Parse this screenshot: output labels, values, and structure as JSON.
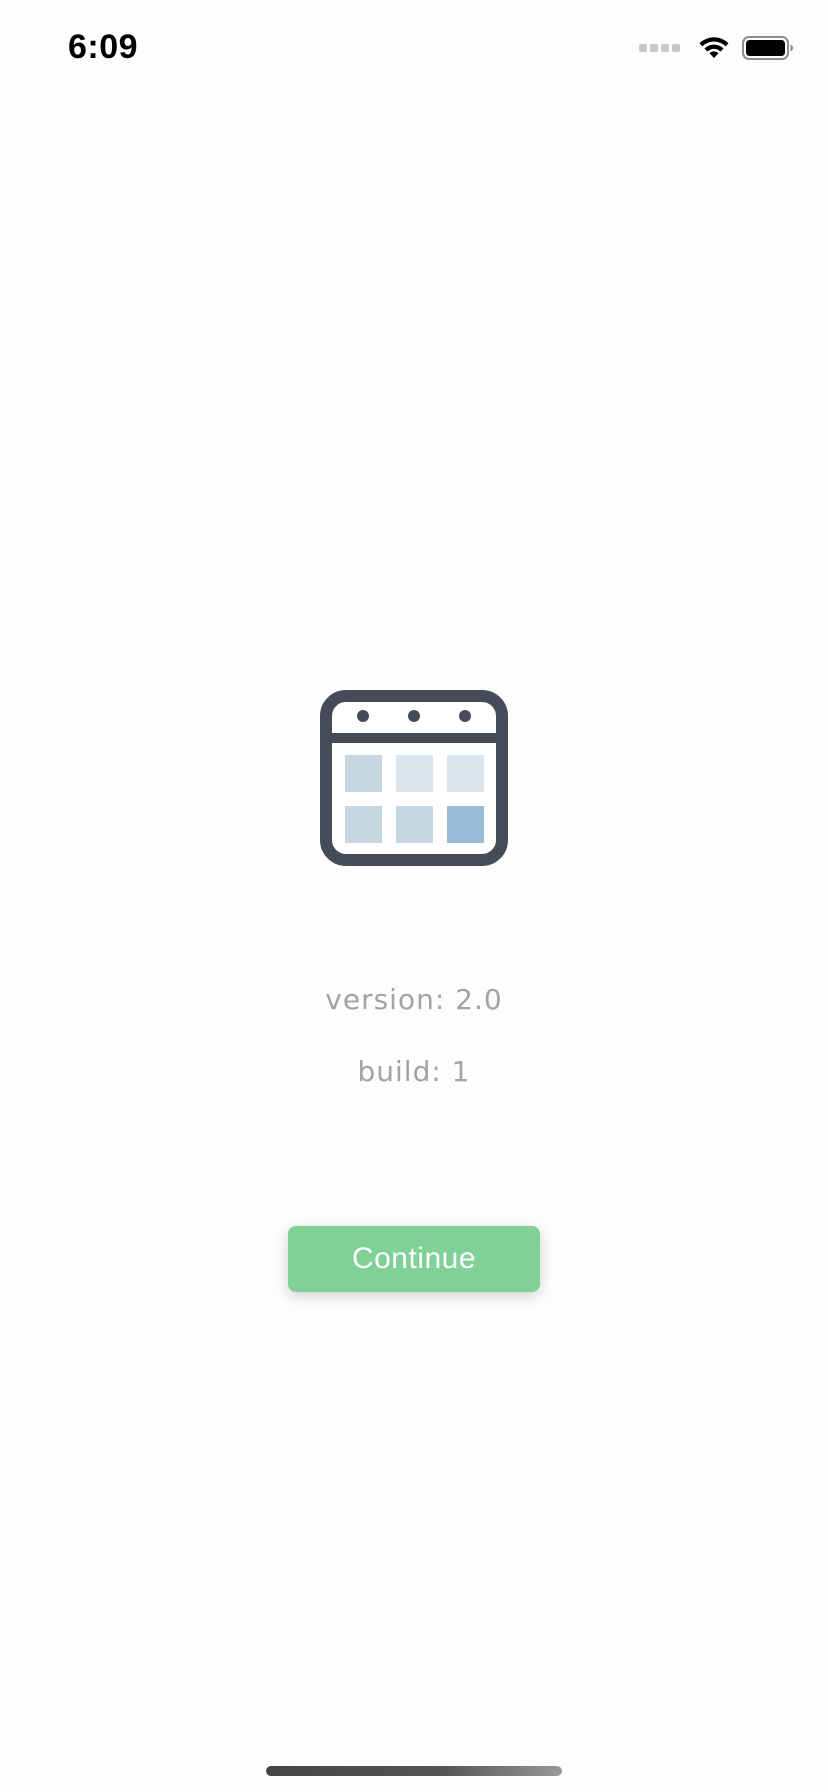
{
  "status_bar": {
    "time": "6:09",
    "icons": [
      "signal-icon",
      "wifi-icon",
      "battery-icon"
    ]
  },
  "app_icon": "calendar-icon",
  "info": {
    "version": "version: 2.0",
    "build": "build: 1"
  },
  "continue_button": {
    "label": "Continue"
  },
  "colors": {
    "button": "#7fd197",
    "text_muted": "#a3a3a3",
    "icon_frame": "#454c57"
  }
}
